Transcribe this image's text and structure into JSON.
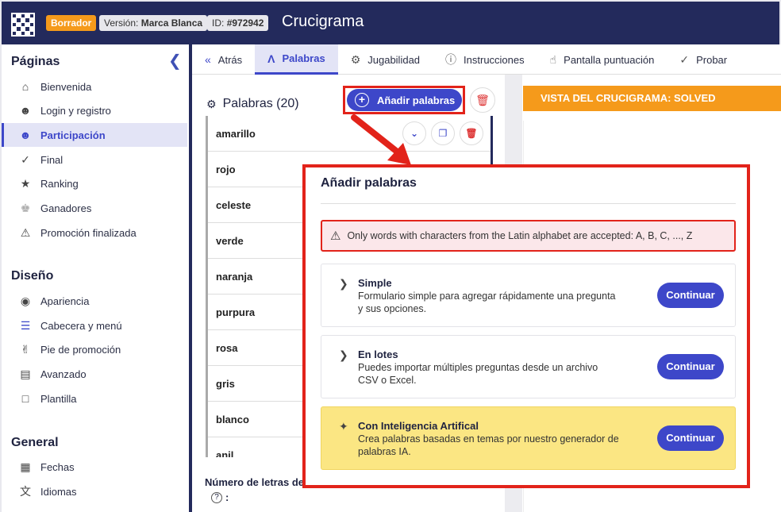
{
  "header": {
    "badge_draft": "Borrador",
    "badge_version_prefix": "Versión:",
    "badge_version_value": "Marca Blanca",
    "badge_id_prefix": "ID:",
    "badge_id_value": "#972942",
    "title": "Crucigrama"
  },
  "sidebar": {
    "section_pages": "Páginas",
    "pages": [
      {
        "label": "Bienvenida",
        "icon": "home-icon"
      },
      {
        "label": "Login y registro",
        "icon": "login-icon"
      },
      {
        "label": "Participación",
        "icon": "participation-icon"
      },
      {
        "label": "Final",
        "icon": "check-icon"
      },
      {
        "label": "Ranking",
        "icon": "ranking-icon"
      },
      {
        "label": "Ganadores",
        "icon": "trophy-icon"
      },
      {
        "label": "Promoción finalizada",
        "icon": "warning-icon"
      }
    ],
    "section_design": "Diseño",
    "design": [
      {
        "label": "Apariencia",
        "icon": "palette-icon"
      },
      {
        "label": "Cabecera y menú",
        "icon": "menu-icon"
      },
      {
        "label": "Pie de promoción",
        "icon": "footer-icon"
      },
      {
        "label": "Avanzado",
        "icon": "advanced-icon"
      },
      {
        "label": "Plantilla",
        "icon": "template-icon"
      }
    ],
    "section_general": "General",
    "general": [
      {
        "label": "Fechas",
        "icon": "calendar-icon"
      },
      {
        "label": "Idiomas",
        "icon": "language-icon"
      }
    ]
  },
  "tabs": [
    {
      "label": "Atrás",
      "icon": "back-icon"
    },
    {
      "label": "Palabras",
      "icon": "words-icon"
    },
    {
      "label": "Jugabilidad",
      "icon": "gear-icon"
    },
    {
      "label": "Instrucciones",
      "icon": "help-icon"
    },
    {
      "label": "Pantalla puntuación",
      "icon": "thumbs-up-icon"
    },
    {
      "label": "Probar",
      "icon": "check-icon"
    }
  ],
  "words_panel": {
    "title": "Palabras (20)",
    "add_button": "Añadir palabras",
    "words": [
      "amarillo",
      "rojo",
      "celeste",
      "verde",
      "naranja",
      "purpura",
      "rosa",
      "gris",
      "blanco",
      "anil"
    ],
    "letters_label": "Número de letras de",
    "help_colon": ":"
  },
  "preview": {
    "banner": "VISTA DEL CRUCIGRAMA: SOLVED"
  },
  "modal": {
    "title": "Añadir palabras",
    "alert": "Only words with characters from the Latin alphabet are accepted: A, B, C, ..., Z",
    "options": [
      {
        "title": "Simple",
        "desc": "Formulario simple para agregar rápidamente una pregunta y sus opciones.",
        "button": "Continuar"
      },
      {
        "title": "En lotes",
        "desc": "Puedes importar múltiples preguntas desde un archivo CSV o Excel.",
        "button": "Continuar"
      },
      {
        "title": "Con Inteligencia Artifical",
        "desc": "Crea palabras basadas en temas por nuestro generador de palabras IA.",
        "button": "Continuar"
      }
    ]
  },
  "colors": {
    "navy": "#232a5c",
    "accent": "#3d47c9",
    "orange": "#f59a1b",
    "highlight_red": "#e2231a",
    "ai_yellow": "#fbe683"
  }
}
